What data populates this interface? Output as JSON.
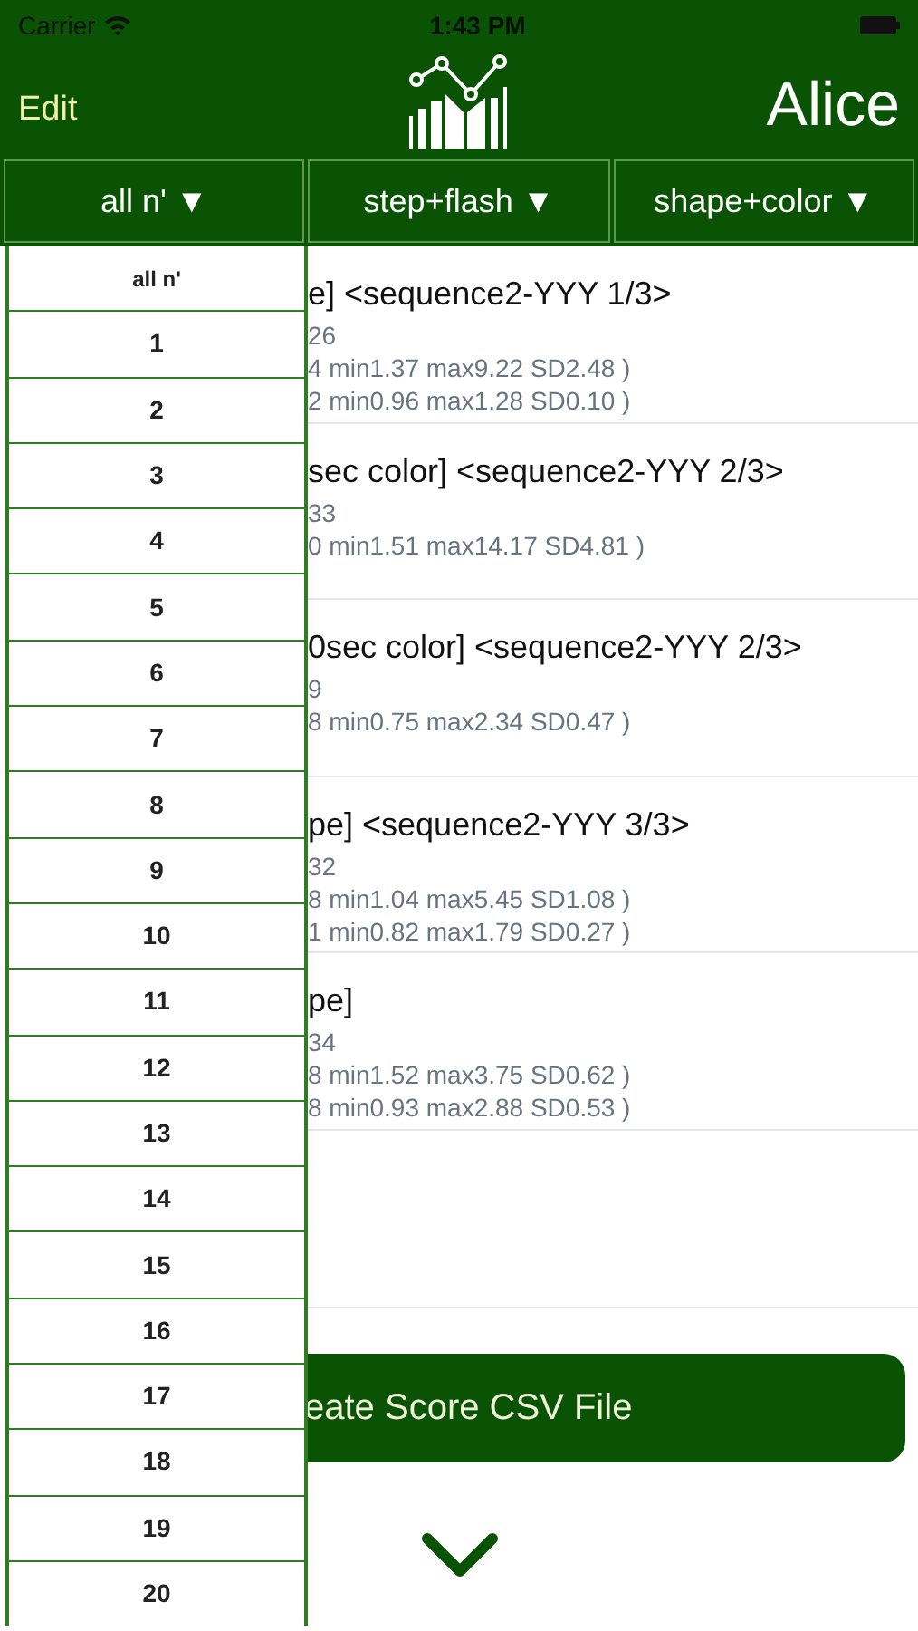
{
  "status_bar": {
    "carrier": "Carrier",
    "time": "1:43 PM"
  },
  "nav": {
    "left": "Edit",
    "title": "Alice"
  },
  "filters": [
    {
      "label": "all n' ▼"
    },
    {
      "label": "step+flash ▼"
    },
    {
      "label": "shape+color ▼"
    }
  ],
  "dropdown": {
    "items": [
      "all n'",
      "1",
      "2",
      "3",
      "4",
      "5",
      "6",
      "7",
      "8",
      "9",
      "10",
      "11",
      "12",
      "13",
      "14",
      "15",
      "16",
      "17",
      "18",
      "19",
      "20"
    ]
  },
  "results": [
    {
      "title": "e] <sequence2-YYY 1/3>",
      "lines": [
        "26",
        "4 min1.37 max9.22 SD2.48 )",
        "2 min0.96 max1.28 SD0.10 )"
      ]
    },
    {
      "title": "sec color] <sequence2-YYY 2/3>",
      "lines": [
        "33",
        "0 min1.51 max14.17 SD4.81 )"
      ]
    },
    {
      "title": "0sec color] <sequence2-YYY 2/3>",
      "lines": [
        "9",
        "8 min0.75 max2.34 SD0.47 )"
      ]
    },
    {
      "title": "pe] <sequence2-YYY 3/3>",
      "lines": [
        "32",
        "8 min1.04 max5.45 SD1.08 )",
        "1 min0.82 max1.79 SD0.27 )"
      ]
    },
    {
      "title": "pe]",
      "lines": [
        "34",
        "8 min1.52 max3.75 SD0.62 )",
        "8 min0.93 max2.88 SD0.53 )"
      ]
    }
  ],
  "button": {
    "label": "eate Score CSV File"
  }
}
